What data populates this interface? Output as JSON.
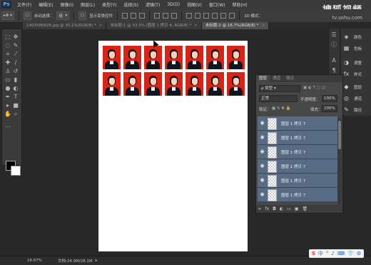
{
  "app": {
    "logo": "Ps"
  },
  "menu": [
    "文件(F)",
    "编辑(E)",
    "图像(I)",
    "图层(L)",
    "类型(Y)",
    "选择(S)",
    "滤镜(T)",
    "3D(D)",
    "视图(V)",
    "窗口(W)",
    "帮助(H)"
  ],
  "watermark": {
    "brand": "搜狐视频",
    "url": "tv.sohu.com"
  },
  "options": {
    "auto_select_label": "自动选择：",
    "auto_select_value": "组",
    "show_transform_label": "显示变换控件",
    "mode_3d_label": "3D 模式："
  },
  "tabs": [
    {
      "label": "1402586826.jpg @ 35.1%(RGB/8) *",
      "active": false
    },
    {
      "label": "未标题-1 @ 33.3% (图层 1 拷贝 4, RGB/8) *",
      "active": false
    },
    {
      "label": "未标题-2 @ 16.7%(RGB/8) *",
      "active": true
    }
  ],
  "status": {
    "zoom": "16.67%",
    "doc": "文档:24.9M/28.1M"
  },
  "dock": {
    "items": [
      {
        "label": "颜色",
        "icon": "color-icon"
      },
      {
        "label": "色板",
        "icon": "swatches-icon"
      },
      {
        "label": "调整",
        "icon": "adjustments-icon"
      },
      {
        "label": "样式",
        "icon": "styles-icon"
      },
      {
        "label": "图层",
        "icon": "layers-icon"
      },
      {
        "label": "通道",
        "icon": "channels-icon"
      },
      {
        "label": "路径",
        "icon": "paths-icon"
      }
    ]
  },
  "layers_panel": {
    "tabs": [
      "图层",
      "通道",
      "路径"
    ],
    "kind_label": "ρ 类型",
    "blend_mode": "正常",
    "opacity_label": "不透明度：",
    "opacity_value": "100%",
    "lock_label": "锁定：",
    "fill_label": "填充：",
    "fill_value": "100%",
    "layers": [
      {
        "name": "图层 1 拷贝 7"
      },
      {
        "name": "图层 1 拷贝 7"
      },
      {
        "name": "图层 1 拷贝 7"
      },
      {
        "name": "图层 1 拷贝 7"
      },
      {
        "name": "图层 1 拷贝 7"
      },
      {
        "name": "图层 1 拷贝 7"
      }
    ]
  },
  "ime": {
    "icons": [
      "S",
      "中",
      "°",
      "♪",
      "⌨",
      "👕",
      "⚙"
    ]
  },
  "colors": {
    "photo_bg": "#d62419",
    "layer_selected": "#586b84",
    "canvas": "#ffffff"
  },
  "photo_grid": {
    "rows": 2,
    "cols": 7
  }
}
